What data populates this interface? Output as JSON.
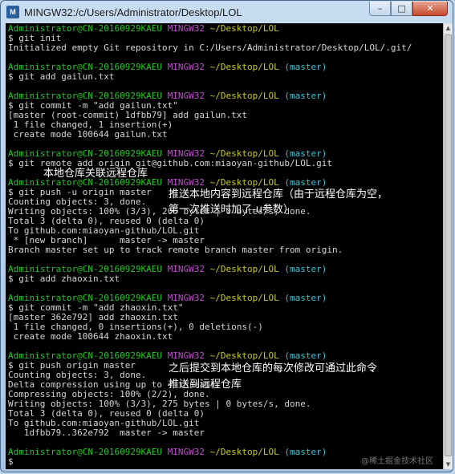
{
  "window": {
    "title": "MINGW32:/c/Users/Administrator/Desktop/LOL",
    "icon_label": "M",
    "controls": {
      "minimize": "–",
      "maximize": "□",
      "close": "✕"
    }
  },
  "prompt": {
    "user": "Administrator@CN-20160929KAEU",
    "env": "MINGW32",
    "path": "~/Desktop/LOL",
    "branch": "(master)"
  },
  "terminal": {
    "lines": [
      {
        "kind": "prompt",
        "branch": false
      },
      {
        "kind": "text",
        "text": "$ git init"
      },
      {
        "kind": "text",
        "text": "Initialized empty Git repository in C:/Users/Administrator/Desktop/LOL/.git/"
      },
      {
        "kind": "text",
        "text": ""
      },
      {
        "kind": "prompt",
        "branch": true
      },
      {
        "kind": "text",
        "text": "$ git add gailun.txt"
      },
      {
        "kind": "text",
        "text": ""
      },
      {
        "kind": "prompt",
        "branch": true
      },
      {
        "kind": "text",
        "text": "$ git commit -m \"add gailun.txt\""
      },
      {
        "kind": "text",
        "text": "[master (root-commit) 1dfbb79] add gailun.txt"
      },
      {
        "kind": "text",
        "text": " 1 file changed, 1 insertion(+)"
      },
      {
        "kind": "text",
        "text": " create mode 100644 gailun.txt"
      },
      {
        "kind": "text",
        "text": ""
      },
      {
        "kind": "prompt",
        "branch": true
      },
      {
        "kind": "text",
        "text": "$ git remote add origin git@github.com:miaoyan-github/LOL.git"
      },
      {
        "kind": "text",
        "text": ""
      },
      {
        "kind": "prompt",
        "branch": true
      },
      {
        "kind": "text",
        "text": "$ git push -u origin master"
      },
      {
        "kind": "text",
        "text": "Counting objects: 3, done."
      },
      {
        "kind": "text",
        "text": "Writing objects: 100% (3/3), 206 bytes | 0 bytes/s, done."
      },
      {
        "kind": "text",
        "text": "Total 3 (delta 0), reused 0 (delta 0)"
      },
      {
        "kind": "text",
        "text": "To github.com:miaoyan-github/LOL.git"
      },
      {
        "kind": "text",
        "text": " * [new branch]      master -> master"
      },
      {
        "kind": "text",
        "text": "Branch master set up to track remote branch master from origin."
      },
      {
        "kind": "text",
        "text": ""
      },
      {
        "kind": "prompt",
        "branch": true
      },
      {
        "kind": "text",
        "text": "$ git add zhaoxin.txt"
      },
      {
        "kind": "text",
        "text": ""
      },
      {
        "kind": "prompt",
        "branch": true
      },
      {
        "kind": "text",
        "text": "$ git commit -m \"add zhaoxin.txt\""
      },
      {
        "kind": "text",
        "text": "[master 362e792] add zhaoxin.txt"
      },
      {
        "kind": "text",
        "text": " 1 file changed, 0 insertions(+), 0 deletions(-)"
      },
      {
        "kind": "text",
        "text": " create mode 100644 zhaoxin.txt"
      },
      {
        "kind": "text",
        "text": ""
      },
      {
        "kind": "prompt",
        "branch": true
      },
      {
        "kind": "text",
        "text": "$ git push origin master"
      },
      {
        "kind": "text",
        "text": "Counting objects: 3, done."
      },
      {
        "kind": "text",
        "text": "Delta compression using up to 4 threads."
      },
      {
        "kind": "text",
        "text": "Compressing objects: 100% (2/2), done."
      },
      {
        "kind": "text",
        "text": "Writing objects: 100% (3/3), 275 bytes | 0 bytes/s, done."
      },
      {
        "kind": "text",
        "text": "Total 3 (delta 0), reused 0 (delta 0)"
      },
      {
        "kind": "text",
        "text": "To github.com:miaoyan-github/LOL.git"
      },
      {
        "kind": "text",
        "text": "   1dfbb79..362e792  master -> master"
      },
      {
        "kind": "text",
        "text": ""
      },
      {
        "kind": "prompt",
        "branch": true
      },
      {
        "kind": "text",
        "text": "$ "
      }
    ]
  },
  "annotations": {
    "remote_note": "本地仓库关联远程仓库",
    "push_note_1": "推送本地内容到远程仓库（由于远程仓库为空，",
    "push_note_2": "第一次推送时加了-u参数）",
    "later_note_1": "之后提交到本地仓库的每次修改可通过此命令",
    "later_note_2": "推送到远程仓库"
  },
  "watermark": "@稀土掘金技术社区",
  "colors": {
    "user": "#21c421",
    "env": "#c54bd3",
    "path": "#c8c81e",
    "branch": "#3fc4d4",
    "text": "#d6d6d6",
    "annotation": "#ffffff"
  }
}
